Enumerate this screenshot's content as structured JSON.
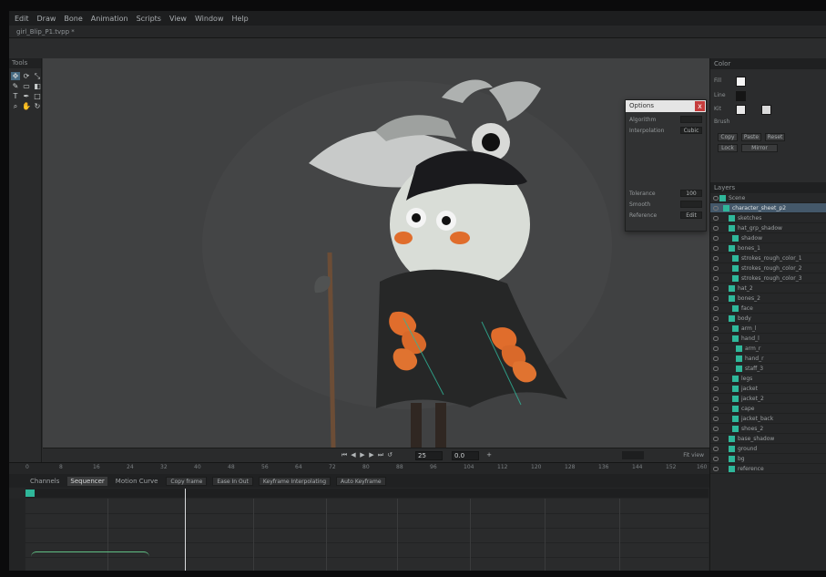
{
  "menu": [
    "Edit",
    "Draw",
    "Bone",
    "Animation",
    "Scripts",
    "View",
    "Window",
    "Help"
  ],
  "document_tab": "girl_Blip_P1.tvpp *",
  "tools": {
    "title": "Tools",
    "icons": [
      "move-icon",
      "rotate-icon",
      "scale-icon",
      "brush-icon",
      "eraser-icon",
      "fill-icon",
      "text-icon",
      "pen-icon",
      "shape-icon",
      "zoom-icon",
      "hand-icon",
      "refresh-icon"
    ]
  },
  "options_panel": {
    "title": "Options",
    "close": "x",
    "rows": [
      {
        "label": "Algorithm",
        "value": ""
      },
      {
        "label": "Interpolation",
        "value": "Cubic"
      },
      {
        "label": "Tolerance",
        "value": "100"
      },
      {
        "label": "Smooth",
        "value": ""
      },
      {
        "label": "Reference",
        "value": "Edit"
      }
    ]
  },
  "playback": {
    "frame_value": "25",
    "total_value": "0.0",
    "zoom_label": "Fit view"
  },
  "timeline": {
    "tabs": [
      "Channels",
      "Sequencer",
      "Motion Curve"
    ],
    "copy_label": "Copy frame",
    "play_label": "Ease In Out",
    "mode_label": "Keyframe Interpolating",
    "extra_label": "Auto Keyframe",
    "ruler_ticks": [
      "0",
      "8",
      "16",
      "24",
      "32",
      "40",
      "48",
      "56",
      "64",
      "72",
      "80",
      "88",
      "96",
      "104",
      "112",
      "120",
      "128",
      "136",
      "144",
      "152",
      "160"
    ]
  },
  "right_panel": {
    "title": "Color",
    "labels": [
      "Fill",
      "Line",
      "Kit",
      "Brush"
    ],
    "buttons": [
      "Copy",
      "Paste",
      "Reset",
      "Lock",
      "Mirror"
    ],
    "layers_title": "Layers",
    "layers": [
      {
        "name": "Scene",
        "selected": false,
        "indent": 4
      },
      {
        "name": "character_sheet_p2",
        "selected": true,
        "indent": 8
      },
      {
        "name": "sketches",
        "selected": false,
        "indent": 14
      },
      {
        "name": "hat_grp_shadow",
        "selected": false,
        "indent": 14
      },
      {
        "name": "shadow",
        "selected": false,
        "indent": 18
      },
      {
        "name": "bones_1",
        "selected": false,
        "indent": 14
      },
      {
        "name": "strokes_rough_color_1",
        "selected": false,
        "indent": 18
      },
      {
        "name": "strokes_rough_color_2",
        "selected": false,
        "indent": 18
      },
      {
        "name": "strokes_rough_color_3",
        "selected": false,
        "indent": 18
      },
      {
        "name": "hat_2",
        "selected": false,
        "indent": 14
      },
      {
        "name": "bones_2",
        "selected": false,
        "indent": 14
      },
      {
        "name": "face",
        "selected": false,
        "indent": 18
      },
      {
        "name": "body",
        "selected": false,
        "indent": 14
      },
      {
        "name": "arm_l",
        "selected": false,
        "indent": 18
      },
      {
        "name": "hand_l",
        "selected": false,
        "indent": 18
      },
      {
        "name": "arm_r",
        "selected": false,
        "indent": 22
      },
      {
        "name": "hand_r",
        "selected": false,
        "indent": 22
      },
      {
        "name": "staff_3",
        "selected": false,
        "indent": 22
      },
      {
        "name": "legs",
        "selected": false,
        "indent": 18
      },
      {
        "name": "jacket",
        "selected": false,
        "indent": 18
      },
      {
        "name": "jacket_2",
        "selected": false,
        "indent": 18
      },
      {
        "name": "cape",
        "selected": false,
        "indent": 18
      },
      {
        "name": "jacket_back",
        "selected": false,
        "indent": 18
      },
      {
        "name": "shoes_2",
        "selected": false,
        "indent": 18
      },
      {
        "name": "base_shadow",
        "selected": false,
        "indent": 14
      },
      {
        "name": "ground",
        "selected": false,
        "indent": 14
      },
      {
        "name": "bg",
        "selected": false,
        "indent": 14
      },
      {
        "name": "reference",
        "selected": false,
        "indent": 14
      }
    ]
  },
  "colors": {
    "accent": "#2fb79a",
    "selection": "#44586a",
    "orange": "#e06d2c"
  }
}
